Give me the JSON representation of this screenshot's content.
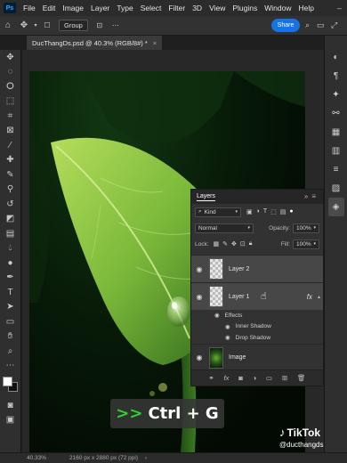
{
  "menu": {
    "logo_label": "Ps",
    "items": [
      "File",
      "Edit",
      "Image",
      "Layer",
      "Type",
      "Select",
      "Filter",
      "3D",
      "View",
      "Plugins",
      "Window",
      "Help"
    ]
  },
  "options_bar": {
    "auto_select_value": "Group",
    "share_label": "Share"
  },
  "document": {
    "tab_title": "DucThangDs.psd @ 40.3% (RGB/8#) *"
  },
  "layers_panel": {
    "title": "Layers",
    "filter_kind": "Kind",
    "blend_mode": "Normal",
    "opacity_label": "Opacity:",
    "opacity_value": "100%",
    "lock_label": "Lock:",
    "fill_label": "Fill:",
    "fill_value": "100%",
    "layers": [
      {
        "name": "Layer 2",
        "selected": true
      },
      {
        "name": "Layer 1",
        "selected": true,
        "fx": "fx"
      },
      {
        "name": "Image",
        "selected": false
      }
    ],
    "effects_label": "Effects",
    "effects": [
      "Inner Shadow",
      "Drop Shadow"
    ]
  },
  "overlay": {
    "arrows": ">>",
    "shortcut": "Ctrl + G"
  },
  "watermark": {
    "brand": "TikTok",
    "handle": "@ducthangds"
  },
  "status_bar": {
    "zoom": "40.33%",
    "doc_size": "2160 px x 2880 px (72 ppi)"
  },
  "colors": {
    "accent": "#1473e6",
    "shortcut_arrows": "#2fd02f",
    "leaf_light": "#9fd14a",
    "leaf_dark": "#2f6a1a"
  }
}
